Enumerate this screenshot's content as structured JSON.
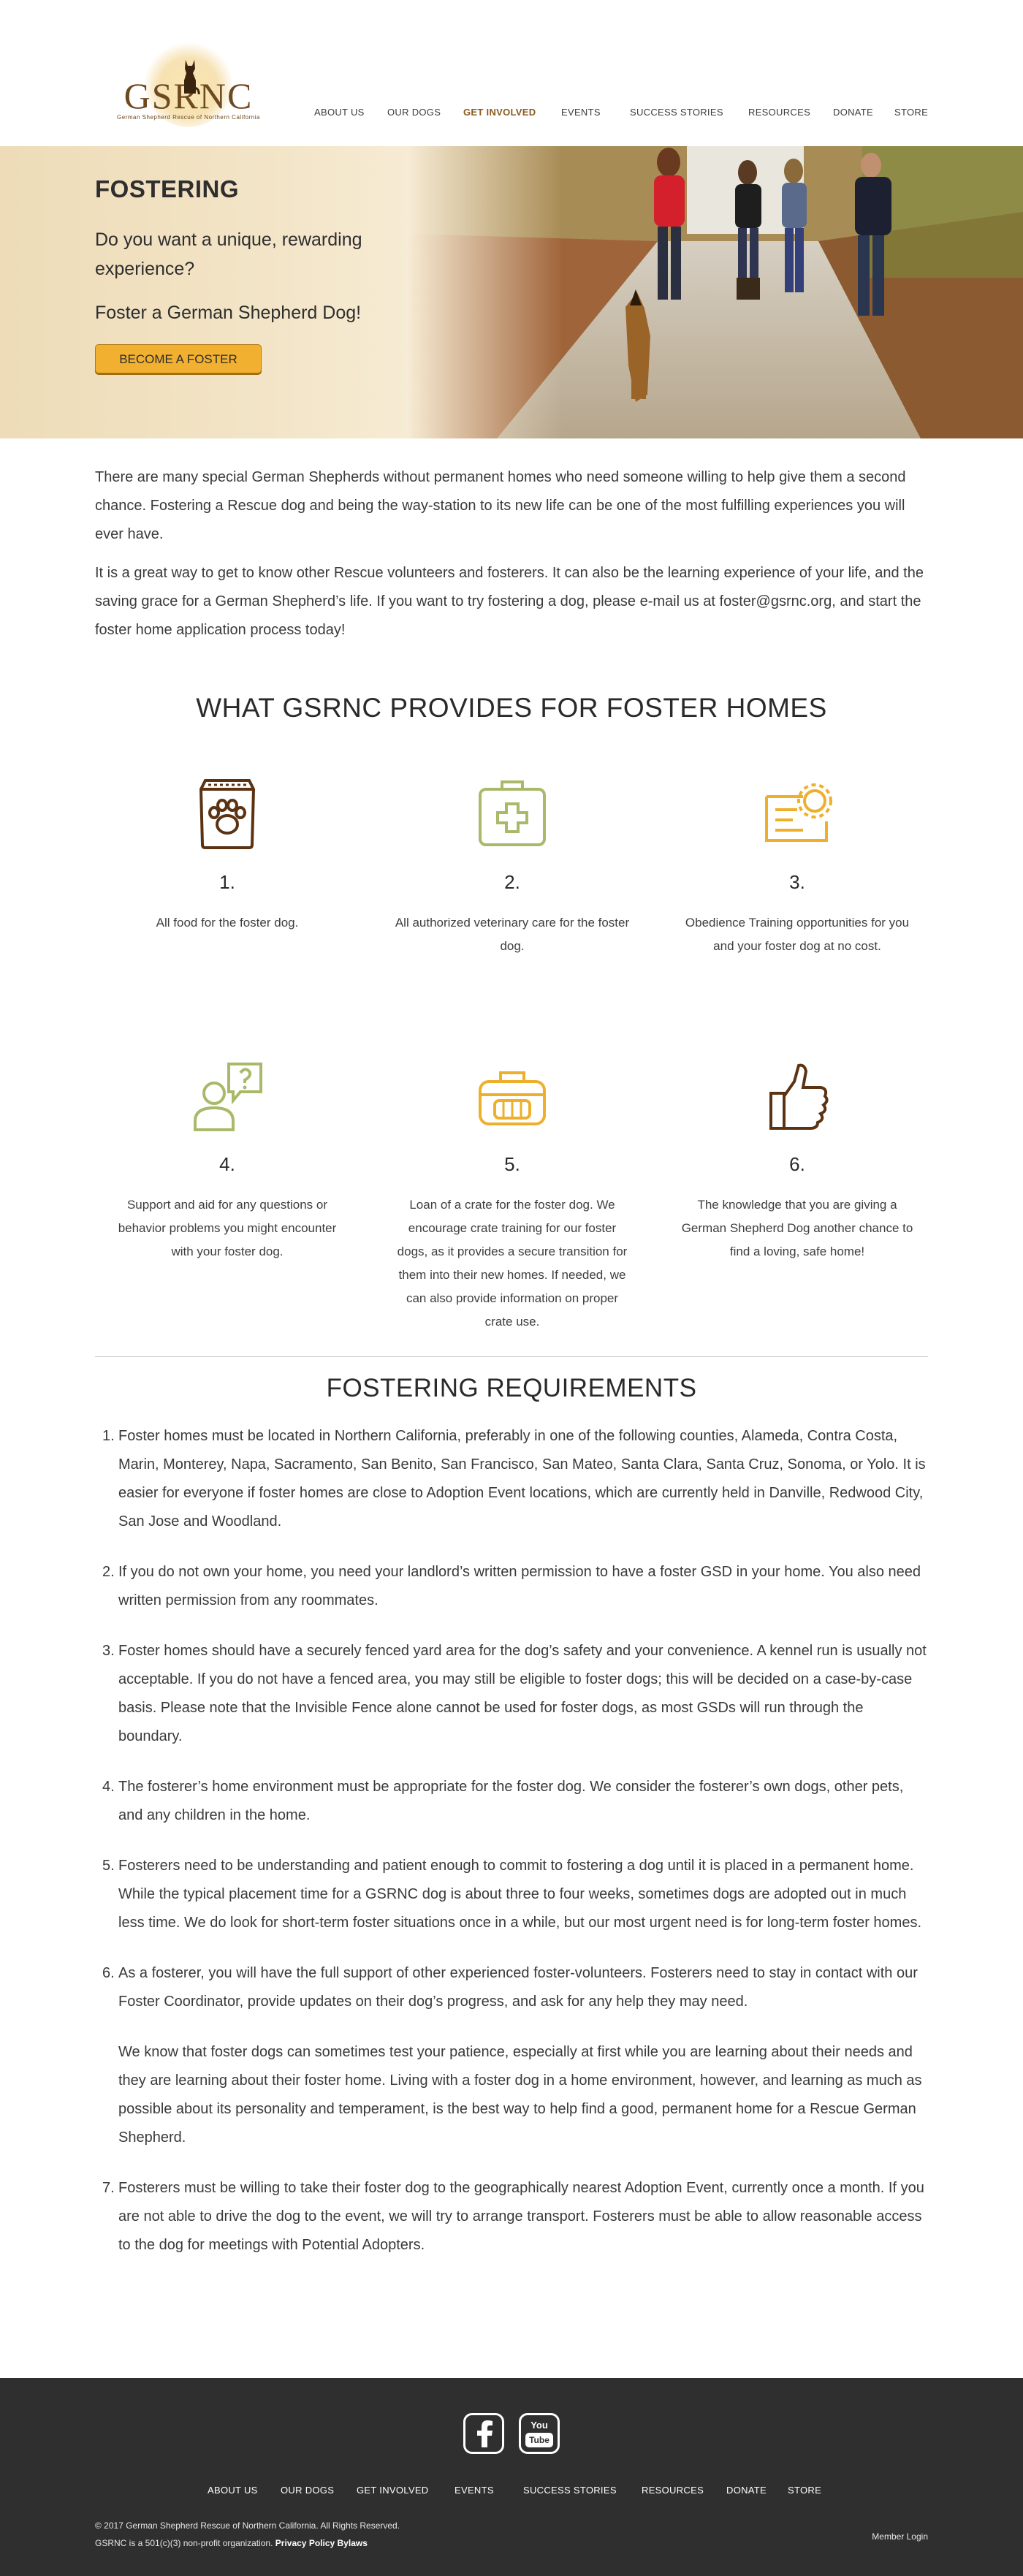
{
  "logo": {
    "text": "GSRNC",
    "subtitle": "German Shepherd Rescue of Northern California"
  },
  "nav": {
    "items": [
      "ABOUT US",
      "OUR DOGS",
      "GET INVOLVED",
      "EVENTS",
      "SUCCESS STORIES",
      "RESOURCES",
      "DONATE",
      "STORE"
    ],
    "active": "GET INVOLVED"
  },
  "hero": {
    "title": "FOSTERING",
    "question": "Do you want a unique, rewarding experience?",
    "subtitle": "Foster a German Shepherd Dog!",
    "button": "BECOME A FOSTER"
  },
  "intro": {
    "p1": "There are many special German Shepherds without permanent homes who need someone willing to help give them a second chance. Fostering a Rescue dog and being the way-station to its new life can be one of the most fulfilling experiences you will ever have.",
    "p2": "It is a great way to get to know other Rescue volunteers and fosterers. It can also be the learning experience of your life, and the saving grace for a German Shepherd’s life. If you want to try fostering a dog, please e-mail us at foster@gsrnc.org, and start the foster home application process today!"
  },
  "provides": {
    "title": "WHAT GSRNC PROVIDES FOR FOSTER HOMES",
    "items": [
      {
        "num": "1.",
        "icon": "food-bag-icon",
        "text": "All food for the foster dog."
      },
      {
        "num": "2.",
        "icon": "first-aid-kit-icon",
        "text": "All authorized veterinary care for the foster dog."
      },
      {
        "num": "3.",
        "icon": "certificate-icon",
        "text": "Obedience Training opportunities for you and your foster dog at no cost."
      },
      {
        "num": "4.",
        "icon": "support-question-icon",
        "text": "Support and aid for any questions or behavior problems you might encounter with your foster dog."
      },
      {
        "num": "5.",
        "icon": "crate-icon",
        "text": "Loan of a crate for the foster dog. We encourage crate training for our foster dogs, as it provides a secure transition for them into their new homes. If needed, we can also provide information on proper crate use."
      },
      {
        "num": "6.",
        "icon": "thumbs-up-icon",
        "text": "The knowledge that you are giving a German Shepherd Dog another chance to find a loving, safe home!"
      }
    ],
    "colors": {
      "brown": "#5b3313",
      "green": "#a9b96a",
      "gold": "#eeb02c"
    }
  },
  "requirements": {
    "title": "FOSTERING REQUIREMENTS",
    "items": [
      {
        "idx": "1.",
        "paras": [
          "Foster homes must be located in Northern California, preferably in one of the following counties, Alameda, Contra Costa, Marin, Monterey, Napa, Sacramento, San Benito, San Francisco, San Mateo, Santa Clara, Santa Cruz, Sonoma, or Yolo. It is easier for everyone if foster homes are close to Adoption Event locations, which are currently held in Danville, Redwood City, San Jose and Woodland."
        ]
      },
      {
        "idx": "2.",
        "paras": [
          "If you do not own your home, you need your landlord’s written permission to have a foster GSD in your home. You also need written permission from any roommates."
        ]
      },
      {
        "idx": "3.",
        "paras": [
          "Foster homes should have a securely fenced yard area for the dog’s safety and your convenience. A kennel run is usually not acceptable. If you do not have a fenced area, you may still be eligible to foster dogs; this will be decided on a case-by-case basis. Please note that the Invisible Fence alone cannot be used for foster dogs, as most GSDs will run through the boundary."
        ]
      },
      {
        "idx": "4.",
        "paras": [
          "The fosterer’s home environment must be appropriate for the foster dog. We consider the fosterer’s own dogs, other pets, and any children in the home."
        ]
      },
      {
        "idx": "5.",
        "paras": [
          "Fosterers need to be understanding and patient enough to commit to fostering a dog until it is placed in a permanent home. While the typical placement time for a GSRNC dog is about three to four weeks, sometimes dogs are adopted out in much less time. We do look for short-term foster situations once in a while, but our most urgent need is for long-term foster homes."
        ]
      },
      {
        "idx": "6.",
        "paras": [
          "As a fosterer, you will have the full support of other experienced foster-volunteers. Fosterers need to stay in contact with our Foster Coordinator, provide updates on their dog’s progress, and ask for any help they may need.",
          "We know that foster dogs can sometimes test your patience, especially at first while you are learning about their needs and they are learning about their foster home. Living with a foster dog in a home environment, however, and learning as much as possible about its personality and temperament, is the best way to help find a good, permanent home for a Rescue German Shepherd."
        ]
      },
      {
        "idx": "7.",
        "paras": [
          "Fosterers must be willing to take their foster dog to the geographically nearest Adoption Event, currently once a month. If you are not able to drive the dog to the event, we will try to arrange transport. Fosterers must be able to allow reasonable access to the dog for meetings with Potential Adopters."
        ]
      }
    ]
  },
  "footer": {
    "social": [
      "facebook-icon",
      "youtube-icon"
    ],
    "youtube_text": [
      "You",
      "Tube"
    ],
    "nav": [
      "ABOUT US",
      "OUR DOGS",
      "GET INVOLVED",
      "EVENTS",
      "SUCCESS STORIES",
      "RESOURCES",
      "DONATE",
      "STORE"
    ],
    "copyright": "©  2017 German Shepherd Rescue of Northern California. All Rights Reserved.",
    "nonprofit": "GSRNC is a 501(c)(3) non-profit organization.",
    "privacy": "Privacy Policy",
    "bylaws": "Bylaws",
    "member_login": "Member Login"
  }
}
